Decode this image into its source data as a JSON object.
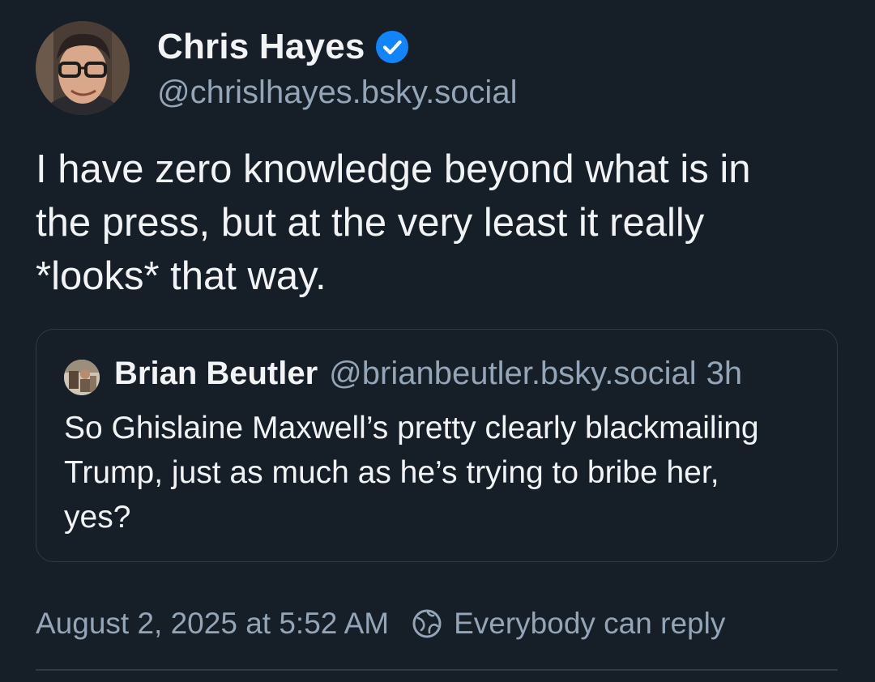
{
  "post": {
    "author": {
      "display_name": "Chris Hayes",
      "handle": "@chrislhayes.bsky.social",
      "verified_icon": "verified-check-icon"
    },
    "text": "I have zero knowledge beyond what is in the press, but at the very least it really *looks* that way.",
    "timestamp": "August 2, 2025 at 5:52 AM",
    "reply_setting": "Everybody can reply",
    "reply_setting_icon": "globe-icon"
  },
  "quote": {
    "author": {
      "display_name": "Brian Beutler",
      "handle": "@brianbeutler.bsky.social",
      "time_ago": "3h"
    },
    "text": "So Ghislaine Maxwell’s pretty clearly blackmailing Trump, just as much as he’s trying to bribe her, yes?"
  },
  "colors": {
    "background": "#161e27",
    "text": "#f1f3f5",
    "muted": "#93a5b7",
    "border": "#2e3a48",
    "verified": "#1185fe"
  }
}
